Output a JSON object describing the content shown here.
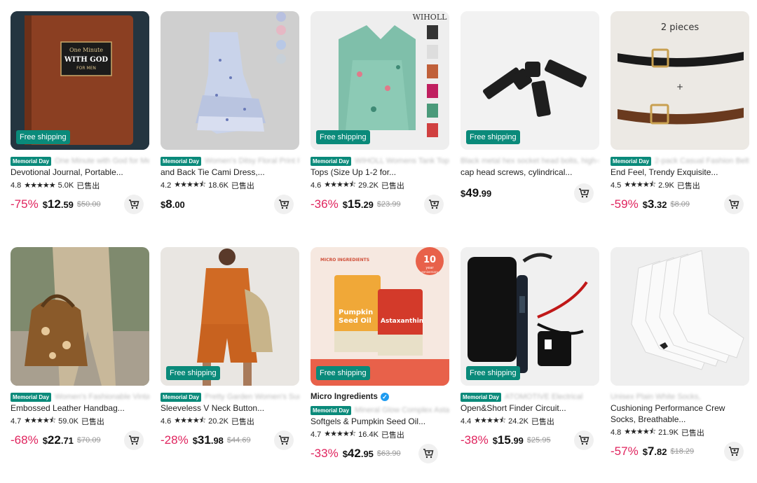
{
  "labels": {
    "free_shipping": "Free shipping",
    "memorial_day": "Memorial Day",
    "sold_suffix": "已售出"
  },
  "products": [
    {
      "id": "journal",
      "free_shipping": true,
      "promo": true,
      "blur_line1": "One Minute with God for Men 365 Days",
      "title": "Devotional Journal, Portable...",
      "rating": "4.8",
      "stars": "★★★★★",
      "sold": "5.0K",
      "discount": "-75%",
      "price_whole": "12",
      "price_cents": ".59",
      "old_price": "$50.00"
    },
    {
      "id": "dress",
      "free_shipping": false,
      "promo": true,
      "blur_line1": "Women's Ditsy Floral Print Ruffle Trim Knot",
      "title": "and Back Tie Cami Dress,...",
      "rating": "4.2",
      "stars": "★★★★⯪",
      "sold": "18.6K",
      "discount": "",
      "price_whole": "8",
      "price_cents": ".00",
      "old_price": ""
    },
    {
      "id": "tank",
      "free_shipping": true,
      "promo": true,
      "blur_line1": "WIHOLL Womens Tank Tops 2025 Flowy Peplum",
      "title": "Tops (Size Up 1-2 for...",
      "rating": "4.6",
      "stars": "★★★★⯪",
      "sold": "29.2K",
      "discount": "-36%",
      "price_whole": "15",
      "price_cents": ".29",
      "old_price": "$23.99"
    },
    {
      "id": "screws",
      "free_shipping": true,
      "promo": false,
      "blur_line1": "Black metal hex socket head bolts, high-strength bolts,",
      "title": "cap head screws, cylindrical...",
      "rating": "",
      "stars": "",
      "sold": "",
      "discount": "",
      "price_whole": "49",
      "price_cents": ".99",
      "old_price": ""
    },
    {
      "id": "belts",
      "free_shipping": false,
      "promo": true,
      "blur_line1": "2-pack Casual Fashion Belt with Simple High-",
      "title": "End Feel, Trendy Exquisite...",
      "rating": "4.5",
      "stars": "★★★★⯪",
      "sold": "2.9K",
      "discount": "-59%",
      "price_whole": "3",
      "price_cents": ".32",
      "old_price": "$8.09"
    },
    {
      "id": "handbag",
      "free_shipping": false,
      "promo": true,
      "blur_line1": "Women's Fashionable Vintage Floral",
      "title": "Embossed Leather Handbag...",
      "rating": "4.7",
      "stars": "★★★★⯪",
      "sold": "59.0K",
      "discount": "-68%",
      "price_whole": "22",
      "price_cents": ".71",
      "old_price": "$70.09"
    },
    {
      "id": "vest",
      "free_shipping": true,
      "promo": true,
      "blur_line1": "Pretty Garden Women's Summer wear",
      "title": "Sleeveless V Neck Button...",
      "rating": "4.6",
      "stars": "★★★★⯪",
      "sold": "20.2K",
      "discount": "-28%",
      "price_whole": "31",
      "price_cents": ".98",
      "old_price": "$44.69"
    },
    {
      "id": "supplement",
      "free_shipping": true,
      "promo": true,
      "brand": "Micro Ingredients",
      "blur_line1": "Mineral Glow Complex Astaxanthin 12mg",
      "title": "Softgels & Pumpkin Seed Oil...",
      "rating": "4.7",
      "stars": "★★★★⯪",
      "sold": "16.4K",
      "discount": "-33%",
      "price_whole": "42",
      "price_cents": ".95",
      "old_price": "$63.90"
    },
    {
      "id": "tester",
      "free_shipping": true,
      "promo": true,
      "blur_line1": "ATOMOTIVE Electrical",
      "title": "Open&Short Finder Circuit...",
      "rating": "4.4",
      "stars": "★★★★⯪",
      "sold": "24.2K",
      "discount": "-38%",
      "price_whole": "15",
      "price_cents": ".99",
      "old_price": "$25.95"
    },
    {
      "id": "socks",
      "free_shipping": false,
      "promo": false,
      "blur_line1": "Unisex Plain White Socks,",
      "title": "Cushioning Performance Crew",
      "title2": "Socks, Breathable...",
      "rating": "4.8",
      "stars": "★★★★⯪",
      "sold": "21.9K",
      "discount": "-57%",
      "price_whole": "7",
      "price_cents": ".82",
      "old_price": "$18.29"
    }
  ],
  "image_text": {
    "journal": [
      "One Minute",
      "WITH GOD",
      "FOR MEN"
    ],
    "tank_brand": "WIHOLL",
    "belts_caption": "2 pieces",
    "belts_plus": "+",
    "supp_logo": "MICRO INGREDIENTS",
    "supp_badge": [
      "10",
      "year",
      "anniversary"
    ],
    "supp_left": [
      "Pumpkin",
      "Seed Oil"
    ],
    "supp_right": "Astaxanthin"
  }
}
